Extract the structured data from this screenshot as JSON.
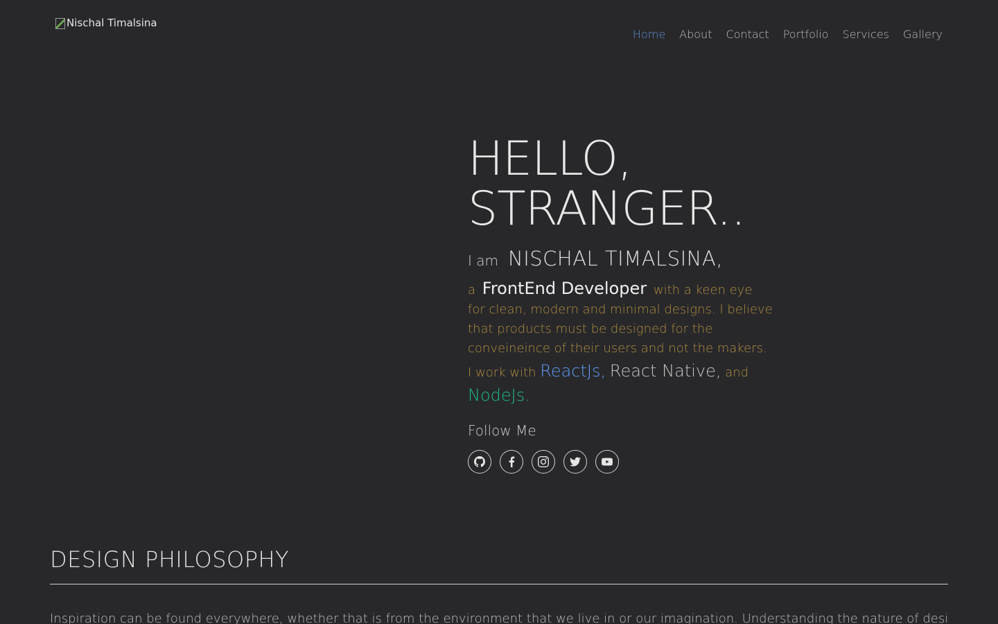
{
  "header": {
    "logo_alt": "Nischal Timalsina",
    "nav": [
      {
        "label": "Home",
        "active": true
      },
      {
        "label": "About"
      },
      {
        "label": "Contact"
      },
      {
        "label": "Portfolio"
      },
      {
        "label": "Services"
      },
      {
        "label": "Gallery"
      }
    ]
  },
  "hero": {
    "line1": "HELLO,",
    "line2": "STRANGER..",
    "iam": "I am",
    "name": "NISCHAL TIMALSINA,",
    "a": "a",
    "role": "FrontEnd Developer",
    "desc": "with a keen eye for clean, modern and minimal designs. I believe that products must be designed for the conveineince of their users and not the makers.",
    "work_with": "I work with",
    "tech1": "ReactJs,",
    "tech2": "React Native,",
    "and": "and",
    "tech3": "NodeJs.",
    "follow": "Follow Me",
    "socials": [
      "github-icon",
      "facebook-icon",
      "instagram-icon",
      "twitter-icon",
      "youtube-icon"
    ]
  },
  "section": {
    "title": "DESIGN PHILOSOPHY",
    "text": "Inspiration can be found everywhere, whether that is from the environment that we live in or our imagination. Understanding the nature of design processes for"
  },
  "colors": {
    "background": "#28282b",
    "accent_nav": "#5b8fd6",
    "desc": "#b08d3c",
    "react": "#5d9cf5",
    "node": "#1fb98a"
  }
}
